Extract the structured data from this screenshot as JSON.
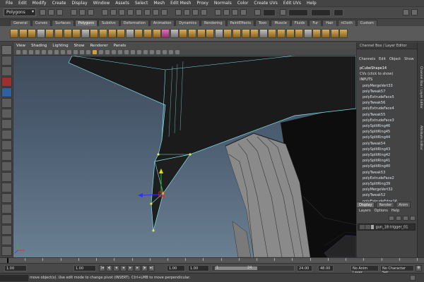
{
  "menubar": {
    "items": [
      "File",
      "Edit",
      "Modify",
      "Create",
      "Display",
      "Window",
      "Assets",
      "Select",
      "Mesh",
      "Edit Mesh",
      "Proxy",
      "Normals",
      "Color",
      "Create UVs",
      "Edit UVs",
      "Help"
    ]
  },
  "statusline": {
    "mode": "Polygons"
  },
  "shelf": {
    "tabs": [
      "General",
      "Curves",
      "Surfaces",
      "Polygons",
      "Subdivs",
      "Deformation",
      "Animation",
      "Dynamics",
      "Rendering",
      "PaintEffects",
      "Toon",
      "Muscle",
      "Fluids",
      "Fur",
      "Hair",
      "nCloth",
      "Custom"
    ],
    "active_tab": "Polygons"
  },
  "panel": {
    "menus": [
      "View",
      "Shading",
      "Lighting",
      "Show",
      "Renderer",
      "Panels"
    ]
  },
  "channel_box": {
    "title": "Channel Box / Layer Editor",
    "menus": [
      "Channels",
      "Edit",
      "Object",
      "Show"
    ],
    "object_name": "pCubeShape14",
    "cvs_label": "CVs (click to show)",
    "inputs_label": "INPUTS",
    "history": [
      "polyMergeVert33",
      "polyTweak57",
      "polyExtrudeFace5",
      "polyTweak56",
      "polyExtrudeFace4",
      "polyTweak55",
      "polyExtrudeFace3",
      "polySplitRing46",
      "polySplitRing45",
      "polySplitRing44",
      "polyTweak54",
      "polySplitRing43",
      "polySplitRing42",
      "polySplitRing41",
      "polySplitRing40",
      "polyTweak53",
      "polyExtrudeFace2",
      "polySplitRing39",
      "polyMergeVert32",
      "polyTweak52",
      "polyExtrudeEdge16"
    ]
  },
  "layer_editor": {
    "tabs": [
      "Display",
      "Render",
      "Anim"
    ],
    "active_tab": "Display",
    "menus": [
      "Layers",
      "Options",
      "Help"
    ],
    "layer_name": "gun_18:trigger_01"
  },
  "attr_strip": {
    "labels": [
      "Channel Box / Layer Editor",
      "Attribute Editor"
    ]
  },
  "time_slider": {
    "ticks": [
      1,
      2,
      3,
      4,
      5,
      6,
      7,
      8,
      9,
      10,
      11,
      12,
      13,
      14,
      15,
      16,
      17,
      18,
      19,
      20,
      21,
      22,
      23,
      24
    ],
    "current_time": "1.00"
  },
  "range_bar": {
    "start": "1.00",
    "playback_start": "1.00",
    "range_start_label": "1",
    "range_end_label": "24",
    "playback_end": "24.00",
    "end": "48.00",
    "anim_layer": "No Anim Layer",
    "character_set": "No Character Set"
  },
  "help_line": {
    "text": "move object(s). Use edit mode to change pivot (INSERT). Ctrl+LMB to move perpendicular."
  },
  "colors": {
    "wire_highlight": "#7fe0ea",
    "vertex": "#e6e64a",
    "manip_x": "#ff2020",
    "manip_y": "#20c020",
    "manip_z": "#3030ff"
  }
}
